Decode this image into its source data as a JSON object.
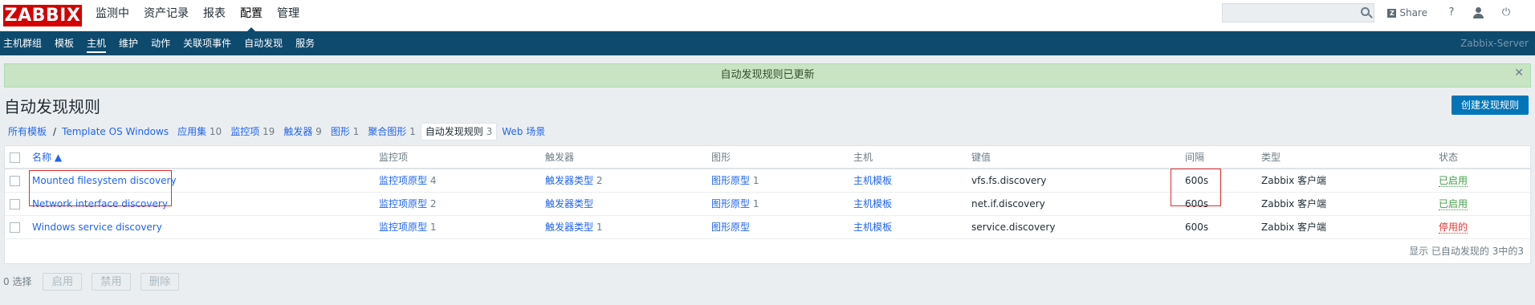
{
  "logo": "ZABBIX",
  "mainmenu": [
    {
      "label": "监测中"
    },
    {
      "label": "资产记录"
    },
    {
      "label": "报表"
    },
    {
      "label": "配置"
    },
    {
      "label": "管理"
    }
  ],
  "topright": {
    "search_placeholder": "",
    "share": "Share",
    "help": "?",
    "power": "⏻"
  },
  "submenu": [
    {
      "label": "主机群组"
    },
    {
      "label": "模板"
    },
    {
      "label": "主机"
    },
    {
      "label": "维护"
    },
    {
      "label": "动作"
    },
    {
      "label": "关联项事件"
    },
    {
      "label": "自动发现"
    },
    {
      "label": "服务"
    }
  ],
  "server_name": "Zabbix-Server",
  "message": "自动发现规则已更新",
  "page_title": "自动发现规则",
  "create_button": "创建发现规则",
  "breadcrumb": {
    "all_templates": "所有模板",
    "separator": "/",
    "template": "Template OS Windows",
    "tabs": [
      {
        "label": "应用集",
        "count": "10"
      },
      {
        "label": "监控项",
        "count": "19"
      },
      {
        "label": "触发器",
        "count": "9"
      },
      {
        "label": "图形",
        "count": "1"
      },
      {
        "label": "聚合图形",
        "count": "1"
      },
      {
        "label": "自动发现规则",
        "count": "3"
      },
      {
        "label": "Web 场景",
        "count": ""
      }
    ]
  },
  "table": {
    "headers": {
      "name": "名称 ▲",
      "items": "监控项",
      "triggers": "触发器",
      "graphs": "图形",
      "hosts": "主机",
      "key": "键值",
      "interval": "间隔",
      "type": "类型",
      "status": "状态"
    },
    "rows": [
      {
        "name": "Mounted filesystem discovery",
        "items": "监控项原型",
        "items_count": "4",
        "triggers": "触发器类型",
        "triggers_count": "2",
        "graphs": "图形原型",
        "graphs_count": "1",
        "hosts": "主机模板",
        "key": "vfs.fs.discovery",
        "interval": "600s",
        "type": "Zabbix 客户端",
        "status": "已启用",
        "status_kind": "ok"
      },
      {
        "name": "Network interface discovery",
        "items": "监控项原型",
        "items_count": "2",
        "triggers": "触发器类型",
        "triggers_count": "",
        "graphs": "图形原型",
        "graphs_count": "1",
        "hosts": "主机模板",
        "key": "net.if.discovery",
        "interval": "600s",
        "type": "Zabbix 客户端",
        "status": "已启用",
        "status_kind": "ok"
      },
      {
        "name": "Windows service discovery",
        "items": "监控项原型",
        "items_count": "1",
        "triggers": "触发器类型",
        "triggers_count": "1",
        "graphs": "图形原型",
        "graphs_count": "",
        "hosts": "主机模板",
        "key": "service.discovery",
        "interval": "600s",
        "type": "Zabbix 客户端",
        "status": "停用的",
        "status_kind": "bad"
      }
    ],
    "footer": "显示 已自动发现的 3中的3"
  },
  "actions": {
    "selected": "0 选择",
    "enable": "启用",
    "disable": "禁用",
    "delete": "删除"
  }
}
